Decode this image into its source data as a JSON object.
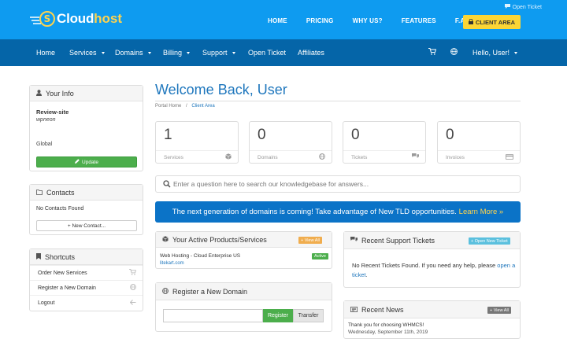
{
  "brand": {
    "name_part1": "Cloud",
    "name_part2": "host",
    "logo_letter": "S"
  },
  "header": {
    "open_ticket": "Open Ticket",
    "nav": [
      "HOME",
      "PRICING",
      "WHY US?",
      "FEATURES",
      "F.A.Q."
    ],
    "client_area": "CLIENT AREA"
  },
  "mainnav": {
    "items": [
      "Home",
      "Services",
      "Domains",
      "Billing",
      "Support",
      "Open Ticket",
      "Affiliates"
    ],
    "user": "Hello, User!"
  },
  "sidebar": {
    "your_info": {
      "title": "Your Info",
      "company": "Review-site",
      "username": "wpneon",
      "group": "Global",
      "update_button": "Update"
    },
    "contacts": {
      "title": "Contacts",
      "empty": "No Contacts Found",
      "new_button": "+ New Contact..."
    },
    "shortcuts": {
      "title": "Shortcuts",
      "items": [
        "Order New Services",
        "Register a New Domain",
        "Logout"
      ]
    }
  },
  "main": {
    "title": "Welcome Back, User",
    "breadcrumb": {
      "home": "Portal Home",
      "sep": "/",
      "current": "Client Area"
    },
    "stats": [
      {
        "value": "1",
        "label": "Services"
      },
      {
        "value": "0",
        "label": "Domains"
      },
      {
        "value": "0",
        "label": "Tickets"
      },
      {
        "value": "0",
        "label": "Invoices"
      }
    ],
    "search_placeholder": "Enter a question here to search our knowledgebase for answers...",
    "banner": {
      "text": "The next generation of domains is coming! Take advantage of New TLD opportunities.",
      "link": "Learn More »"
    }
  },
  "products": {
    "title": "Your Active Products/Services",
    "view_all": "+ View All",
    "item_name": "Web Hosting - Cloud Enterprise US",
    "item_domain": "litekart.com",
    "status": "Active"
  },
  "register": {
    "title": "Register a New Domain",
    "register_btn": "Register",
    "transfer_btn": "Transfer"
  },
  "tickets": {
    "title": "Recent Support Tickets",
    "open_new": "+ Open New Ticket",
    "empty_text": "No Recent Tickets Found. If you need any help, please",
    "open_link": "open a ticket",
    "period": "."
  },
  "news": {
    "title": "Recent News",
    "view_all": "+ View All",
    "item_title": "Thank you for choosing WHMCS!",
    "item_date": "Wednesday, September 11th, 2019"
  },
  "colors": {
    "header_blue": "#0e9bf0",
    "nav_blue": "#0565a8",
    "accent_yellow": "#fcd535",
    "link_blue": "#1f77bd",
    "success_green": "#4cae4c"
  }
}
